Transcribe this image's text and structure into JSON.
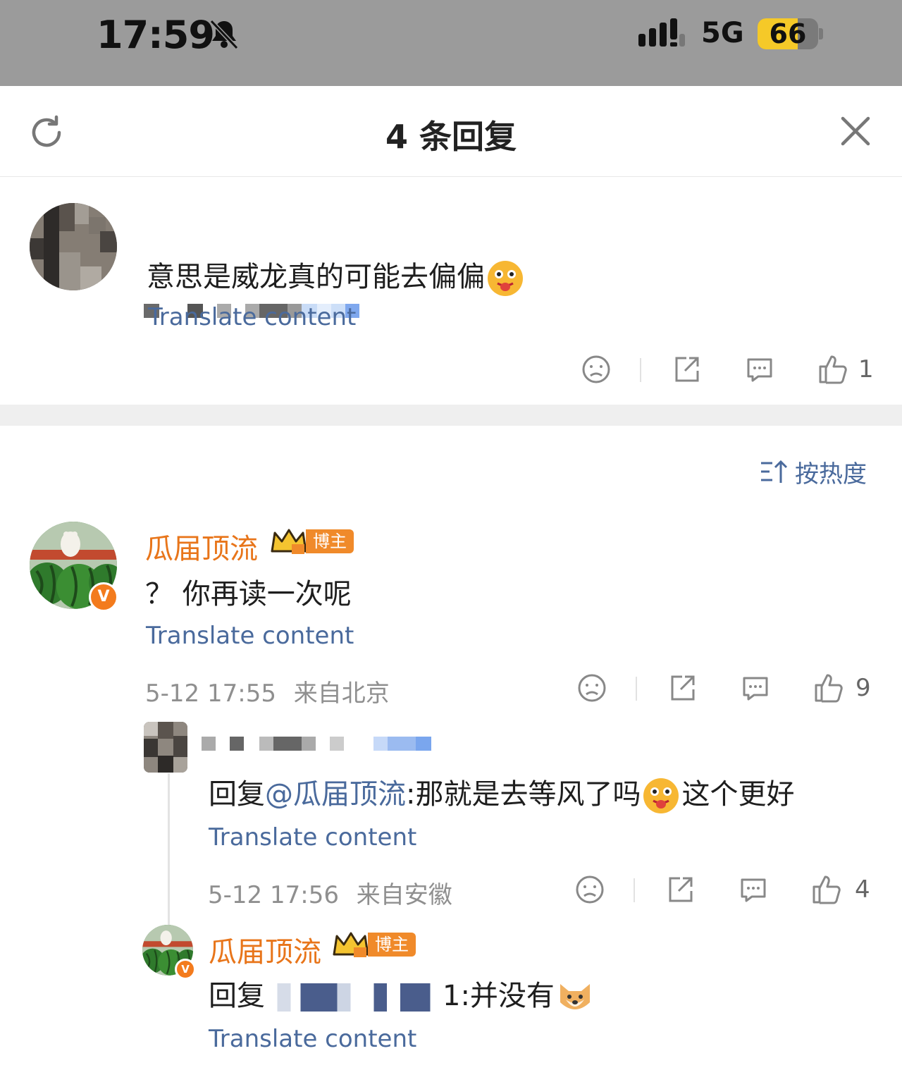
{
  "status_bar": {
    "time": "17:59",
    "network": "5G",
    "battery_level": "66",
    "battery_fraction": 0.66,
    "icons": [
      "bell-muted-icon",
      "signal-icon"
    ]
  },
  "sheet": {
    "title": "4 条回复",
    "icons": [
      "refresh-icon",
      "close-icon"
    ]
  },
  "root_comment": {
    "text": "意思是威龙真的可能去偏偏",
    "translate_label": "Translate content",
    "like_count": "1",
    "icons": [
      "dislike-icon",
      "share-icon",
      "comment-icon",
      "like-icon"
    ]
  },
  "sort": {
    "label": "按热度",
    "icon": "sort-icon"
  },
  "replies": [
    {
      "author": "瓜届顶流",
      "badge_label": "博主",
      "text": "？ 你再读一次呢",
      "translate_label": "Translate content",
      "date": "5-12 17:55",
      "location": "来自北京",
      "like_count": "9"
    },
    {
      "reply_prefix": "回复",
      "mention": "@瓜届顶流",
      "text_before_emoji": ":那就是去等风了吗",
      "text_after_emoji": "这个更好",
      "translate_label": "Translate content",
      "date": "5-12 17:56",
      "location": "来自安徽",
      "like_count": "4"
    },
    {
      "author": "瓜届顶流",
      "badge_label": "博主",
      "reply_prefix": "回复",
      "text_suffix": "1:并没有",
      "translate_label": "Translate content"
    }
  ],
  "colors": {
    "link_blue": "#4a6a9c",
    "author_orange": "#e8751a",
    "battery_yellow": "#f5c928",
    "status_gray": "#9b9b9b"
  }
}
